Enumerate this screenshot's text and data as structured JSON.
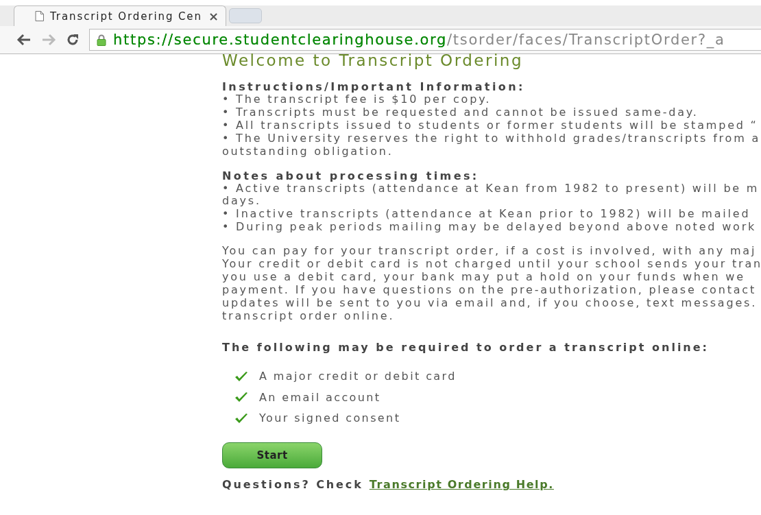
{
  "browser": {
    "tab_title": "Transcript Ordering Cen",
    "tab_close": "×",
    "url_host": "https://secure.studentclearinghouse.org",
    "url_path": "/tsorder/faces/TranscriptOrder?_a"
  },
  "page": {
    "title": "Welcome to Transcript Ordering",
    "sections": [
      {
        "heading": "Instructions/Important Information:",
        "items": [
          {
            "lines": [
              "• The transcript fee is $10 per copy."
            ]
          },
          {
            "lines": [
              "• Transcripts must be requested and cannot be issued same-day."
            ]
          },
          {
            "lines": [
              "• All transcripts issued to students or former students will be stamped “"
            ]
          },
          {
            "lines": [
              "• The University reserves the right to withhold grades/transcripts from a",
              "outstanding obligation."
            ]
          }
        ]
      },
      {
        "heading": "Notes about processing times:",
        "items": [
          {
            "lines": [
              "• Active transcripts (attendance at Kean from 1982 to present) will be m",
              "days."
            ]
          },
          {
            "lines": [
              "• Inactive transcripts (attendance at Kean prior to 1982) will be mailed"
            ]
          },
          {
            "lines": [
              "• During peak periods mailing may be delayed beyond above noted work"
            ]
          }
        ]
      }
    ],
    "paragraph": [
      "You can pay for your transcript order, if a cost is involved, with any maj",
      "Your credit or debit card is not charged until your school sends your tran",
      "you use a debit card, your bank may put a hold on your funds when we",
      "payment. If you have questions on the pre-authorization, please contact",
      "updates will be sent to you via email and, if you choose, text messages.",
      "transcript order online."
    ],
    "requirements_heading": "The following may be required to order a transcript online:",
    "requirements": [
      "A major credit or debit card",
      "An email account",
      "Your signed consent"
    ],
    "start_button": "Start",
    "questions": "Questions? Check",
    "help_link": "Transcript Ordering Help."
  }
}
